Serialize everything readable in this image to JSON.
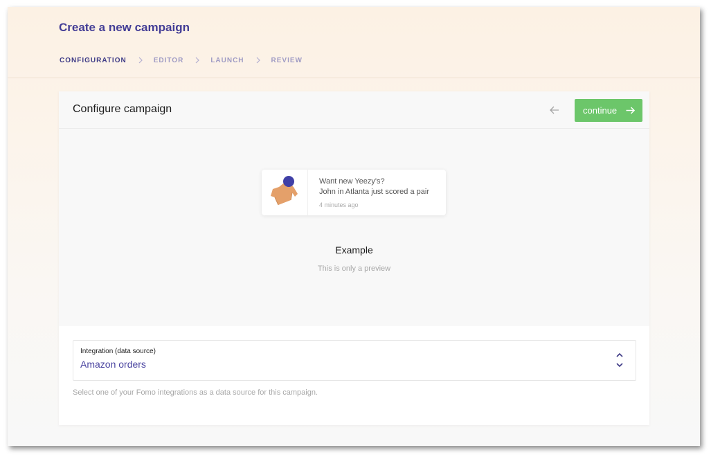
{
  "page": {
    "title": "Create a new campaign"
  },
  "steps": [
    {
      "label": "CONFIGURATION",
      "active": true
    },
    {
      "label": "EDITOR",
      "active": false
    },
    {
      "label": "LAUNCH",
      "active": false
    },
    {
      "label": "REVIEW",
      "active": false
    }
  ],
  "card": {
    "title": "Configure campaign",
    "back_icon": "arrow-left-icon",
    "continue_label": "continue",
    "continue_icon": "arrow-right-icon"
  },
  "preview": {
    "notification": {
      "line1": "Want new Yeezy's?",
      "line2": "John in Atlanta just scored a pair",
      "time": "4 minutes ago",
      "image_icon": "sweater-icon"
    },
    "title": "Example",
    "subtitle": "This is only a preview"
  },
  "integration": {
    "label": "Integration (data source)",
    "value": "Amazon orders",
    "helper": "Select one of your Fomo integrations as a data source for this campaign."
  },
  "colors": {
    "brand": "#433d96",
    "continue": "#6cc66a",
    "sweater": "#e4a06a",
    "ball": "#3f3fa6"
  }
}
